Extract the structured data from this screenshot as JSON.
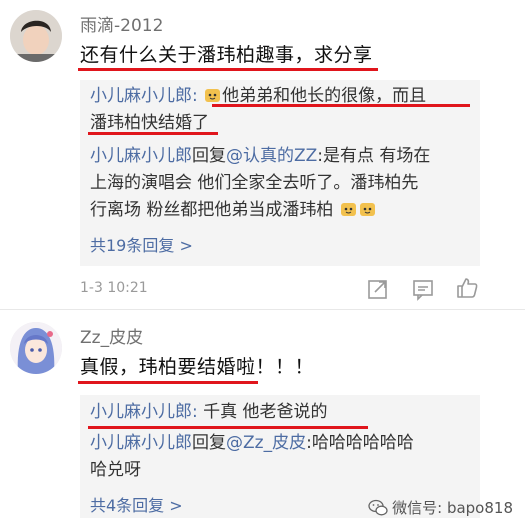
{
  "comments": [
    {
      "username": "雨滴-2012",
      "text": "还有什么关于潘玮柏趣事，求分享",
      "time": "1-3 10:21",
      "replies": [
        {
          "name": "小儿麻小儿郎",
          "sep": ":",
          "line1": "他弟弟和他长的很像，而且",
          "line2": "潘玮柏快结婚了"
        },
        {
          "name": "小儿麻小儿郎",
          "mid": "回复",
          "target": "@认真的ZZ",
          "sep": ":",
          "line1": "是有点 有场在",
          "line2": "上海的演唱会 他们全家全去听了。潘玮柏先",
          "line3": "行离场  粉丝都把他弟当成潘玮柏"
        }
      ],
      "more": "共19条回复 >"
    },
    {
      "username": "Zz_皮皮",
      "text": "真假，玮柏要结婚啦！！！",
      "replies": [
        {
          "name": "小儿麻小儿郎",
          "sep": ":",
          "line1": " 千真 他老爸说的"
        },
        {
          "name": "小儿麻小儿郎",
          "mid": "回复",
          "target": "@Zz_皮皮",
          "sep": ":",
          "line1": "哈哈哈哈哈哈",
          "line2": "哈兑呀"
        }
      ],
      "more": "共4条回复 >"
    }
  ],
  "watermark": "微信号: bapo818",
  "colors": {
    "underline": "#e0151c",
    "link": "#4d6ca3",
    "reply_bg": "#f4f4f4"
  },
  "icons": [
    "share-icon",
    "comment-icon",
    "like-icon",
    "emoji-icon",
    "wechat-icon"
  ]
}
